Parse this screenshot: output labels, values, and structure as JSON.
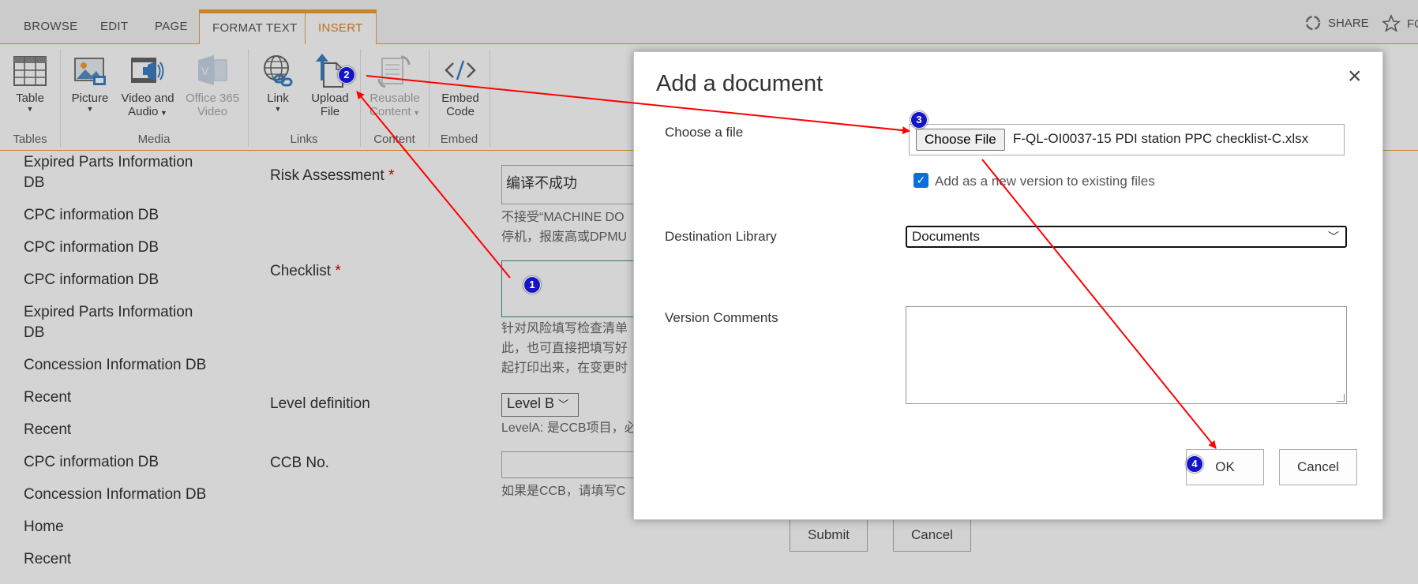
{
  "tabs": [
    {
      "label": "BROWSE"
    },
    {
      "label": "EDIT"
    },
    {
      "label": "PAGE"
    },
    {
      "label": "FORMAT TEXT"
    },
    {
      "label": "INSERT"
    }
  ],
  "top_right": {
    "share": "SHARE",
    "follow": "FO"
  },
  "ribbon": {
    "buttons": [
      {
        "label": "Table",
        "icon": "table-icon"
      },
      {
        "label": "Picture",
        "icon": "picture-icon"
      },
      {
        "label": "Video and Audio",
        "line1": "Video and",
        "line2": "Audio",
        "icon": "video-audio-icon"
      },
      {
        "label": "Office 365 Video",
        "line1": "Office 365",
        "line2": "Video",
        "icon": "office365-video-icon"
      },
      {
        "label": "Link",
        "icon": "link-icon"
      },
      {
        "label": "Upload File",
        "line1": "Upload",
        "line2": "File",
        "icon": "upload-file-icon"
      },
      {
        "label": "Reusable Content",
        "line1": "Reusable",
        "line2": "Content",
        "icon": "reusable-content-icon"
      },
      {
        "label": "Embed Code",
        "line1": "Embed",
        "line2": "Code",
        "icon": "embed-code-icon"
      }
    ],
    "groups": [
      "Tables",
      "Media",
      "Links",
      "Content",
      "Embed"
    ]
  },
  "nav": {
    "items": [
      {
        "line1": "Expired Parts Information",
        "line2": "DB"
      },
      {
        "line1": "CPC information DB"
      },
      {
        "line1": "CPC information DB"
      },
      {
        "line1": "CPC information DB"
      },
      {
        "line1": "Expired Parts Information",
        "line2": "DB"
      },
      {
        "line1": "Concession Information DB"
      },
      {
        "line1": "Recent"
      },
      {
        "line1": "Recent"
      },
      {
        "line1": "CPC information DB"
      },
      {
        "line1": "Concession Information DB"
      },
      {
        "line1": "Home"
      },
      {
        "line1": "Recent"
      }
    ]
  },
  "form": {
    "risk_label": "Risk Assessment",
    "required_mark": "*",
    "risk_value": "编译不成功",
    "risk_hint1": "不接受“MACHINE DO",
    "risk_hint2": "停机，报废高或DPMU",
    "checklist_label": "Checklist",
    "checklist_hint1": "针对风险填写检查清单",
    "checklist_hint2": "此，也可直接把填写好",
    "checklist_hint3": "起打印出来，在变更时",
    "level_label": "Level definition",
    "level_value": "Level B",
    "level_hint": "LevelA: 是CCB项目，必",
    "ccb_label": "CCB No.",
    "ccb_hint": "如果是CCB，请填写C",
    "submit": "Submit",
    "cancel": "Cancel"
  },
  "dialog": {
    "title": "Add a document",
    "close": "×",
    "choose_file_label": "Choose a file",
    "choose_file_button": "Choose File",
    "file_name": "F-QL-OI0037-15 PDI station PPC checklist-C.xlsx",
    "checkbox_checked": true,
    "checkbox_label": "Add as a new version to existing files",
    "destination_label": "Destination Library",
    "destination_value": "Documents",
    "comments_label": "Version Comments",
    "ok": "OK",
    "cancel": "Cancel"
  },
  "annotations": {
    "markers": [
      "1",
      "2",
      "3",
      "4"
    ],
    "arrow_color": "#ff0000",
    "marker_color": "#1515c8"
  },
  "colors": {
    "accent": "#f0a030",
    "insert_tab_text": "#e0852a",
    "checkbox": "#0a6fdb"
  }
}
